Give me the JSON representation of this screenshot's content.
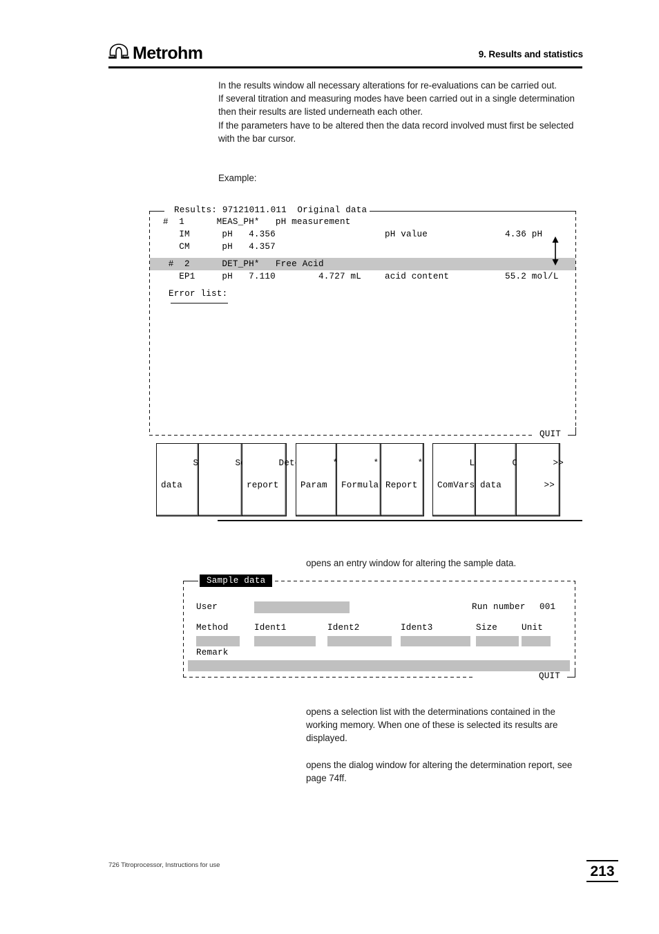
{
  "header": {
    "brand": "Metrohm",
    "logo_icon": "metrohm-omega-arch-icon",
    "section_title": "9. Results and statistics"
  },
  "intro": {
    "paragraph": "In the results window all necessary alterations for re-evaluations can be carried out.\nIf several titration and measuring modes have been carried out in a single determination then their results are listed underneath each other.\nIf the parameters have to be altered then the data record involved must first be selected with the bar cursor.",
    "example_label": "Example:"
  },
  "results_window": {
    "title": "Results: 97121011.011  Original data",
    "quit_label": "QUIT",
    "scroll_icon": "up-down-arrow-icon",
    "rows": [
      {
        "cols": "#  1      MEAS_PH*   pH measurement"
      },
      {
        "cols": "   IM      pH   4.356"
      },
      {
        "cols": "   CM      pH   4.357"
      },
      {
        "cols": " #  2      DET_PH*   Free Acid"
      },
      {
        "cols": "   EP1     pH   7.110        4.727 mL"
      }
    ],
    "row1_result_name": "pH value",
    "row1_result_value": "4.36 pH",
    "row5_result_name": "acid content",
    "row5_result_value": "55.2 mol/L",
    "error_list_label": "Error list:"
  },
  "softkeys": [
    {
      "line1": "Sample",
      "line2": "data",
      "align": "left"
    },
    {
      "line1": "Select",
      "line2": "",
      "align": "left"
    },
    {
      "line1": "Determ.",
      "line2": "report",
      "align": "left"
    },
    {
      "line1": "*",
      "line2": "Param",
      "align": "left"
    },
    {
      "line1": "*",
      "line2": "Formula",
      "align": "left"
    },
    {
      "line1": "*",
      "line2": "Report",
      "align": "left"
    },
    {
      "line1": "Local",
      "line2": "ComVars",
      "align": "left"
    },
    {
      "line1": "Calib.",
      "line2": "data",
      "align": "left"
    },
    {
      "line1": ">>",
      "line2": ">>",
      "align": "right"
    }
  ],
  "descriptions": {
    "sample_data": "opens an entry window for altering the sample data.",
    "select": "opens a selection list with the determinations contained in the working memory. When one of these is selected its results are displayed.",
    "determ_report": "opens the dialog window for altering the determination report, see page 74ff."
  },
  "sample_window": {
    "title": "Sample data",
    "quit_label": "QUIT",
    "user_label": "User",
    "user_value": "",
    "run_number_label": "Run number",
    "run_number_value": "001",
    "fields": [
      {
        "label": "Method",
        "value": ""
      },
      {
        "label": "Ident1",
        "value": ""
      },
      {
        "label": "Ident2",
        "value": ""
      },
      {
        "label": "Ident3",
        "value": ""
      },
      {
        "label": "Size",
        "value": ""
      },
      {
        "label": "Unit",
        "value": ""
      }
    ],
    "remark_label": "Remark",
    "remark_value": ""
  },
  "footer": {
    "note": "726 Titroprocessor, Instructions for use",
    "page_number": "213"
  }
}
